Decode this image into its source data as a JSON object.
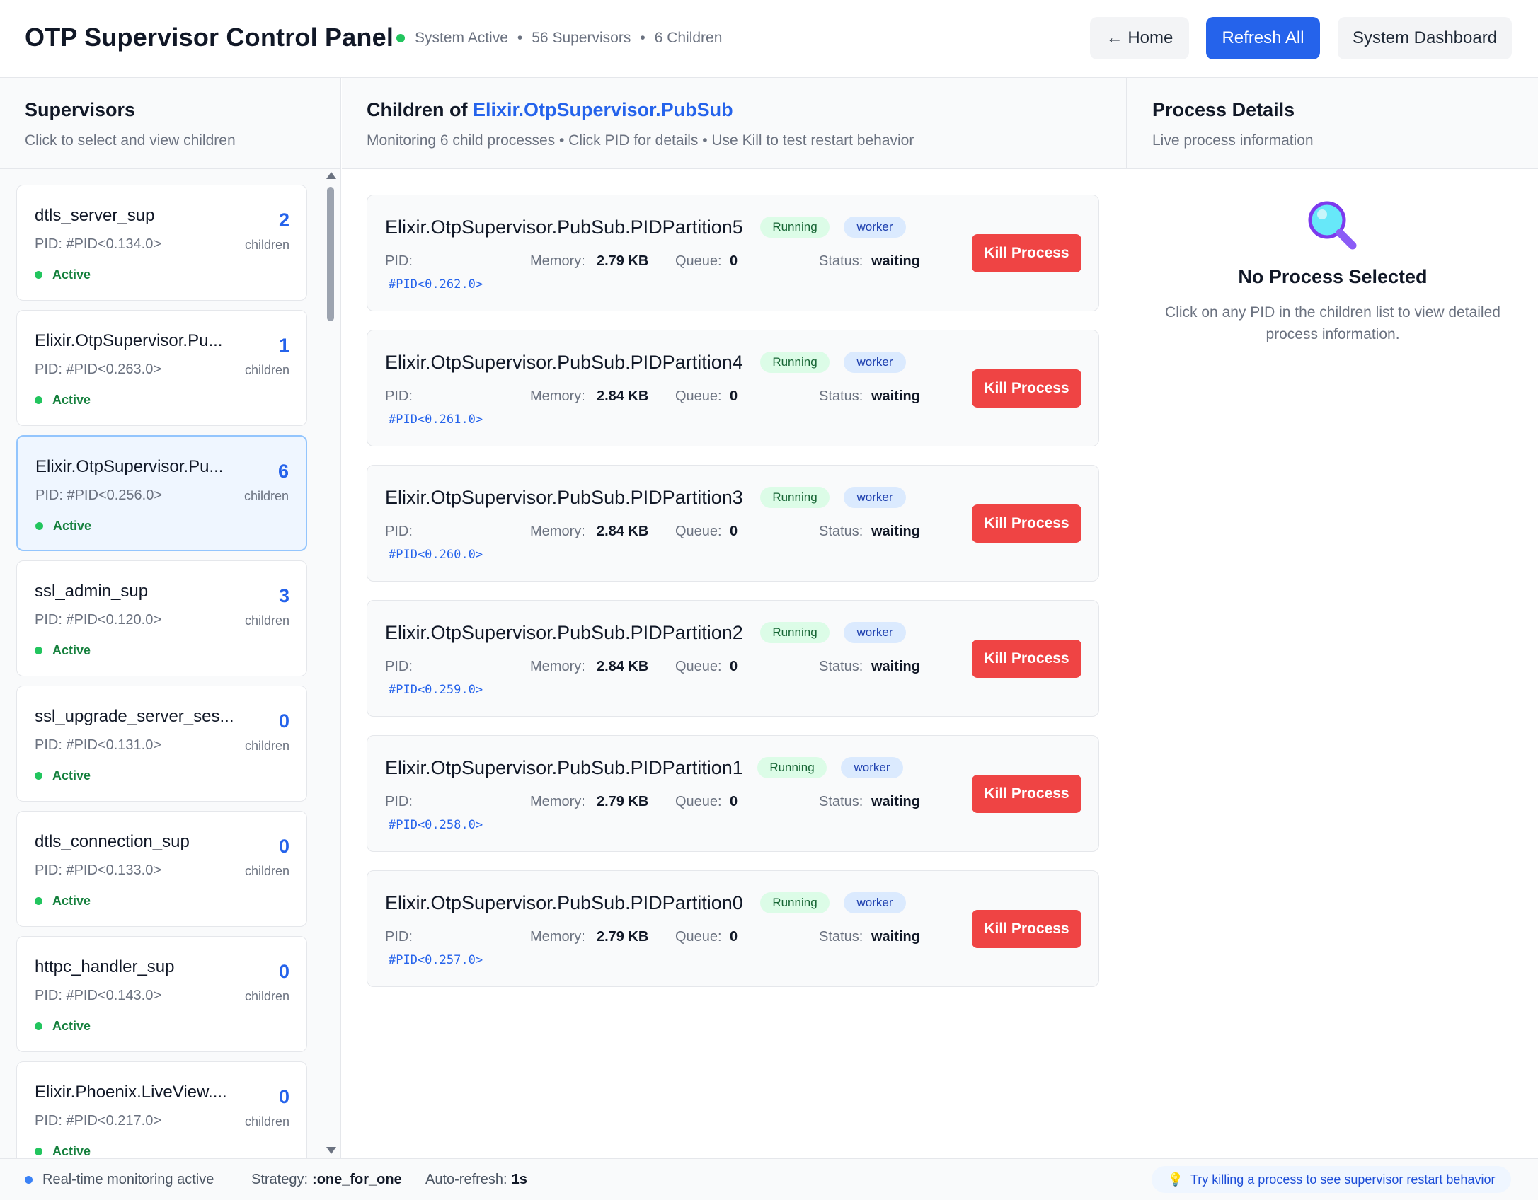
{
  "header": {
    "title": "OTP Supervisor Control Panel",
    "status": "System Active",
    "supervisors": "56 Supervisors",
    "children": "6 Children",
    "separator": "•",
    "home_label": "← Home",
    "refresh_label": "Refresh All",
    "dashboard_label": "System Dashboard"
  },
  "columns": {
    "supervisors_title": "Supervisors",
    "supervisors_sub": "Click to select and view children",
    "children_prefix": "Children of ",
    "children_supervisor": "Elixir.OtpSupervisor.PubSub",
    "children_sub": "Monitoring 6 child processes • Click PID for details • Use Kill to test restart behavior",
    "details_title": "Process Details",
    "details_sub": "Live process information"
  },
  "supervisors": [
    {
      "name": "dtls_server_sup",
      "pid": "PID: #PID<0.134.0>",
      "count": "2",
      "count_label": "children",
      "state": "Active"
    },
    {
      "name": "Elixir.OtpSupervisor.Pu...",
      "pid": "PID: #PID<0.263.0>",
      "count": "1",
      "count_label": "children",
      "state": "Active"
    },
    {
      "name": "Elixir.OtpSupervisor.Pu...",
      "pid": "PID: #PID<0.256.0>",
      "count": "6",
      "count_label": "children",
      "state": "Active"
    },
    {
      "name": "ssl_admin_sup",
      "pid": "PID: #PID<0.120.0>",
      "count": "3",
      "count_label": "children",
      "state": "Active"
    },
    {
      "name": "ssl_upgrade_server_ses...",
      "pid": "PID: #PID<0.131.0>",
      "count": "0",
      "count_label": "children",
      "state": "Active"
    },
    {
      "name": "dtls_connection_sup",
      "pid": "PID: #PID<0.133.0>",
      "count": "0",
      "count_label": "children",
      "state": "Active"
    },
    {
      "name": "httpc_handler_sup",
      "pid": "PID: #PID<0.143.0>",
      "count": "0",
      "count_label": "children",
      "state": "Active"
    },
    {
      "name": "Elixir.Phoenix.LiveView....",
      "pid": "PID: #PID<0.217.0>",
      "count": "0",
      "count_label": "children",
      "state": "Active"
    }
  ],
  "selected_supervisor_index": 2,
  "children": [
    {
      "name": "Elixir.OtpSupervisor.PubSub.PIDPartition5",
      "state": "Running",
      "type": "worker",
      "pid_label": "PID:",
      "pid": "#PID<0.262.0>",
      "memory_label": "Memory:",
      "memory": "2.79 KB",
      "queue_label": "Queue:",
      "queue": "0",
      "status_label": "Status:",
      "status": "waiting",
      "kill_label": "Kill Process"
    },
    {
      "name": "Elixir.OtpSupervisor.PubSub.PIDPartition4",
      "state": "Running",
      "type": "worker",
      "pid_label": "PID:",
      "pid": "#PID<0.261.0>",
      "memory_label": "Memory:",
      "memory": "2.84 KB",
      "queue_label": "Queue:",
      "queue": "0",
      "status_label": "Status:",
      "status": "waiting",
      "kill_label": "Kill Process"
    },
    {
      "name": "Elixir.OtpSupervisor.PubSub.PIDPartition3",
      "state": "Running",
      "type": "worker",
      "pid_label": "PID:",
      "pid": "#PID<0.260.0>",
      "memory_label": "Memory:",
      "memory": "2.84 KB",
      "queue_label": "Queue:",
      "queue": "0",
      "status_label": "Status:",
      "status": "waiting",
      "kill_label": "Kill Process"
    },
    {
      "name": "Elixir.OtpSupervisor.PubSub.PIDPartition2",
      "state": "Running",
      "type": "worker",
      "pid_label": "PID:",
      "pid": "#PID<0.259.0>",
      "memory_label": "Memory:",
      "memory": "2.84 KB",
      "queue_label": "Queue:",
      "queue": "0",
      "status_label": "Status:",
      "status": "waiting",
      "kill_label": "Kill Process"
    },
    {
      "name": "Elixir.OtpSupervisor.PubSub.PIDPartition1",
      "state": "Running",
      "type": "worker",
      "pid_label": "PID:",
      "pid": "#PID<0.258.0>",
      "memory_label": "Memory:",
      "memory": "2.79 KB",
      "queue_label": "Queue:",
      "queue": "0",
      "status_label": "Status:",
      "status": "waiting",
      "kill_label": "Kill Process"
    },
    {
      "name": "Elixir.OtpSupervisor.PubSub.PIDPartition0",
      "state": "Running",
      "type": "worker",
      "pid_label": "PID:",
      "pid": "#PID<0.257.0>",
      "memory_label": "Memory:",
      "memory": "2.79 KB",
      "queue_label": "Queue:",
      "queue": "0",
      "status_label": "Status:",
      "status": "waiting",
      "kill_label": "Kill Process"
    }
  ],
  "details": {
    "icon": "magnifier-icon",
    "empty_title": "No Process Selected",
    "empty_text": "Click on any PID in the children list to view detailed process information."
  },
  "footer": {
    "monitoring": "Real-time monitoring active",
    "strategy_label": "Strategy:",
    "strategy": ":one_for_one",
    "refresh_label": "Auto-refresh:",
    "refresh": "1s",
    "tip": "Try killing a process to see supervisor restart behavior"
  },
  "colors": {
    "accent": "#2563eb",
    "danger": "#ef4444",
    "success": "#22c55e"
  }
}
